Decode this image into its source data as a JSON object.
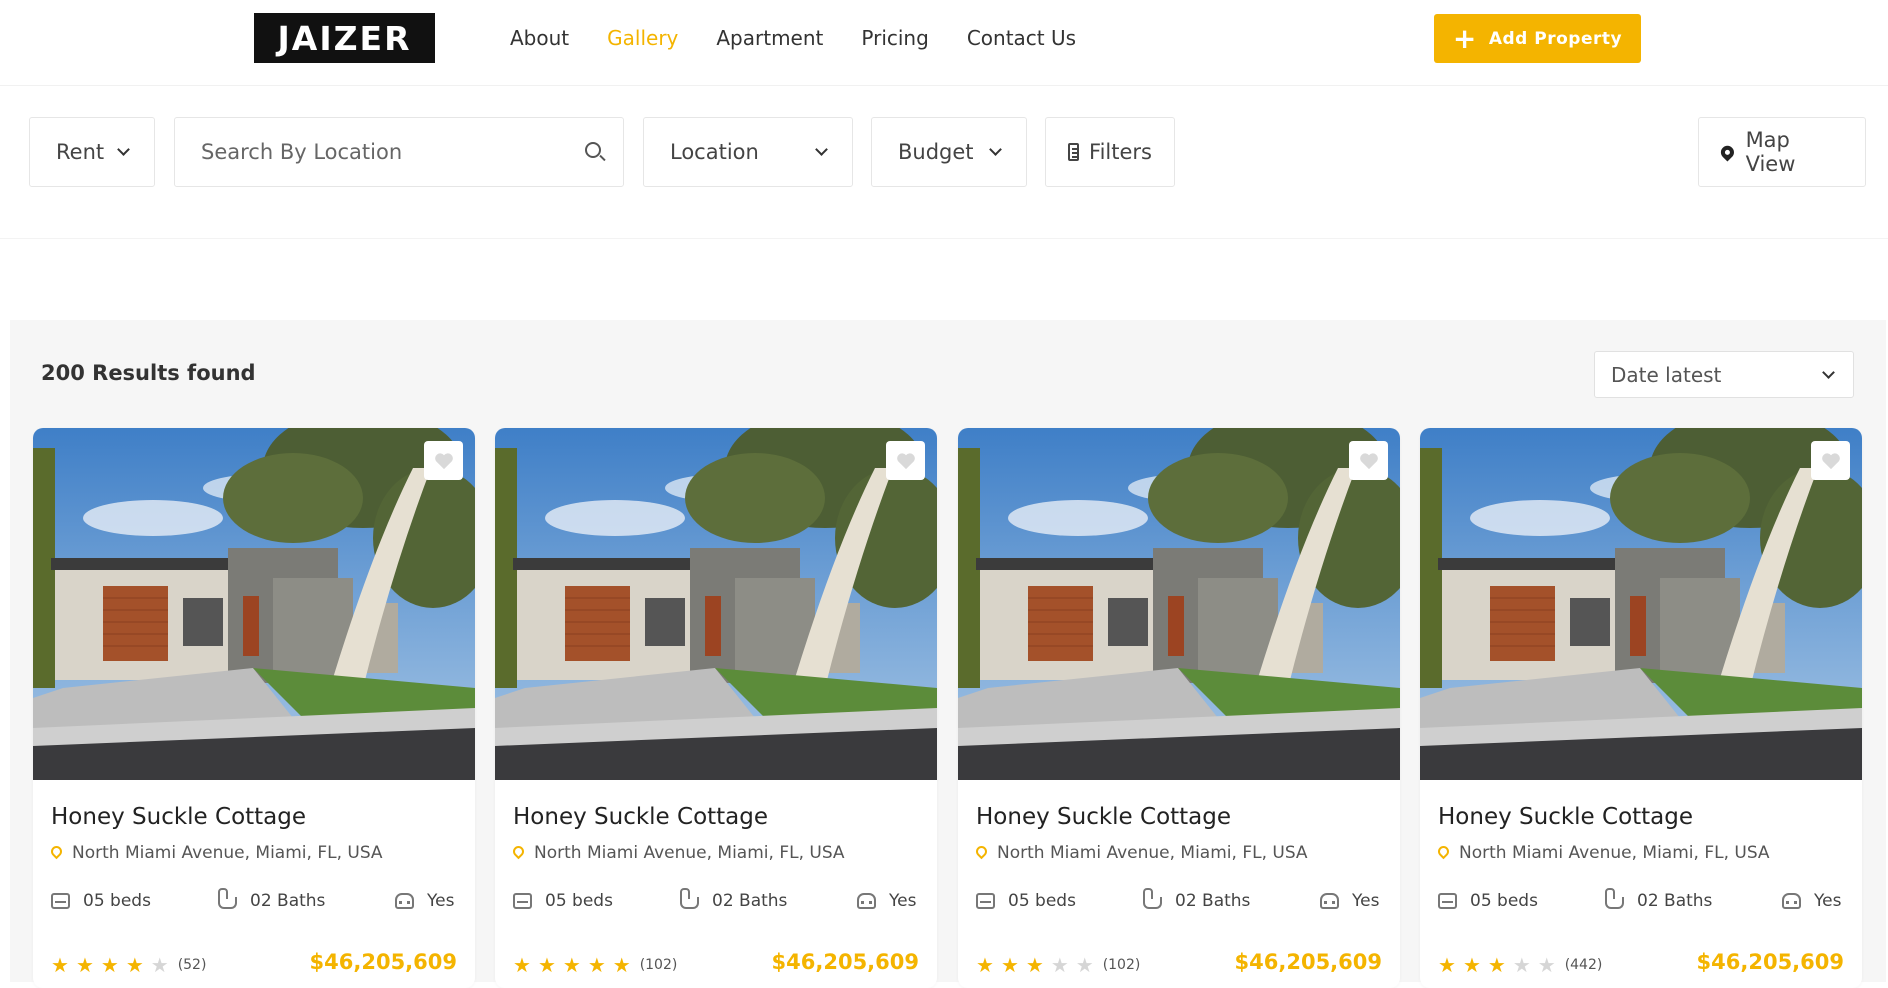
{
  "header": {
    "logo_text": "JAIZER",
    "nav": [
      {
        "label": "About",
        "active": false
      },
      {
        "label": "Gallery",
        "active": true
      },
      {
        "label": "Apartment",
        "active": false
      },
      {
        "label": "Pricing",
        "active": false
      },
      {
        "label": "Contact Us",
        "active": false
      }
    ],
    "add_property_label": "Add Property",
    "accent_color": "#f4b400"
  },
  "filters": {
    "type_label": "Rent",
    "search_placeholder": "Search By Location",
    "location_label": "Location",
    "budget_label": "Budget",
    "filters_label": "Filters",
    "map_view_label": "Map View"
  },
  "results": {
    "count_label": "200 Results found",
    "sort_label": "Date latest"
  },
  "listings": [
    {
      "title": "Honey Suckle Cottage",
      "location": "North Miami Avenue, Miami, FL, USA",
      "beds": "05 beds",
      "baths": "02 Baths",
      "parking": "Yes",
      "rating": 4,
      "reviews": "(52)",
      "price": "$46,205,609"
    },
    {
      "title": "Honey Suckle Cottage",
      "location": "North Miami Avenue, Miami, FL, USA",
      "beds": "05 beds",
      "baths": "02 Baths",
      "parking": "Yes",
      "rating": 5,
      "reviews": "(102)",
      "price": "$46,205,609"
    },
    {
      "title": "Honey Suckle Cottage",
      "location": "North Miami Avenue, Miami, FL, USA",
      "beds": "05 beds",
      "baths": "02 Baths",
      "parking": "Yes",
      "rating": 3,
      "reviews": "(102)",
      "price": "$46,205,609"
    },
    {
      "title": "Honey Suckle Cottage",
      "location": "North Miami Avenue, Miami, FL, USA",
      "beds": "05 beds",
      "baths": "02 Baths",
      "parking": "Yes",
      "rating": 3,
      "reviews": "(442)",
      "price": "$46,205,609"
    }
  ]
}
